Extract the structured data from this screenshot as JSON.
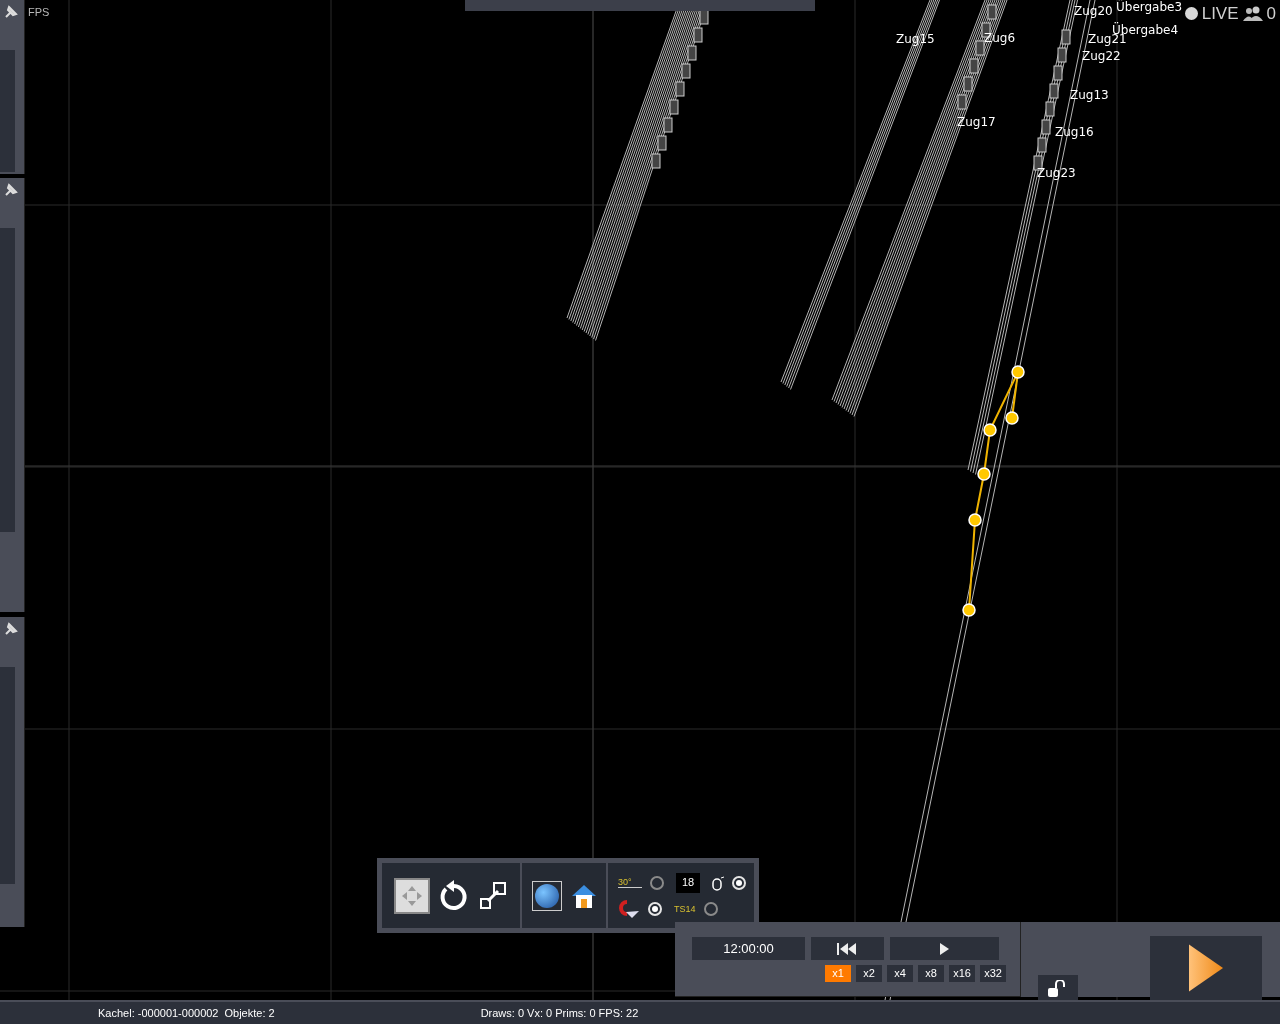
{
  "overlay": {
    "fps_label": "FPS",
    "live_label": "LIVE",
    "user_count": "0"
  },
  "map": {
    "train_labels": [
      {
        "text": "Zug15"
      },
      {
        "text": "Zug6"
      },
      {
        "text": "Zug17"
      },
      {
        "text": "Zug20"
      },
      {
        "text": "Übergabe3"
      },
      {
        "text": "Übergabe4"
      },
      {
        "text": "Zug21"
      },
      {
        "text": "Zug22"
      },
      {
        "text": "Zug13"
      },
      {
        "text": "Zug16"
      },
      {
        "text": "Zug23"
      }
    ]
  },
  "toolbar": {
    "angle_label": "30°",
    "counter": "18",
    "axis_label": "TS14",
    "options": [
      {
        "kind": "angle",
        "selected": false
      },
      {
        "kind": "mouse",
        "selected": true
      },
      {
        "kind": "magnet",
        "selected": true
      },
      {
        "kind": "axis",
        "selected": false
      }
    ]
  },
  "playback": {
    "time": "12:00:00",
    "speeds": [
      {
        "label": "x1",
        "selected": true
      },
      {
        "label": "x2",
        "selected": false
      },
      {
        "label": "x4",
        "selected": false
      },
      {
        "label": "x8",
        "selected": false
      },
      {
        "label": "x16",
        "selected": false
      },
      {
        "label": "x32",
        "selected": false
      }
    ]
  },
  "status_bar": {
    "tile": "Kachel: -000001-000002",
    "objects": "Objekte: 2",
    "stats": "Draws: 0 Vx: 0 Prims: 0 FPS: 22"
  }
}
